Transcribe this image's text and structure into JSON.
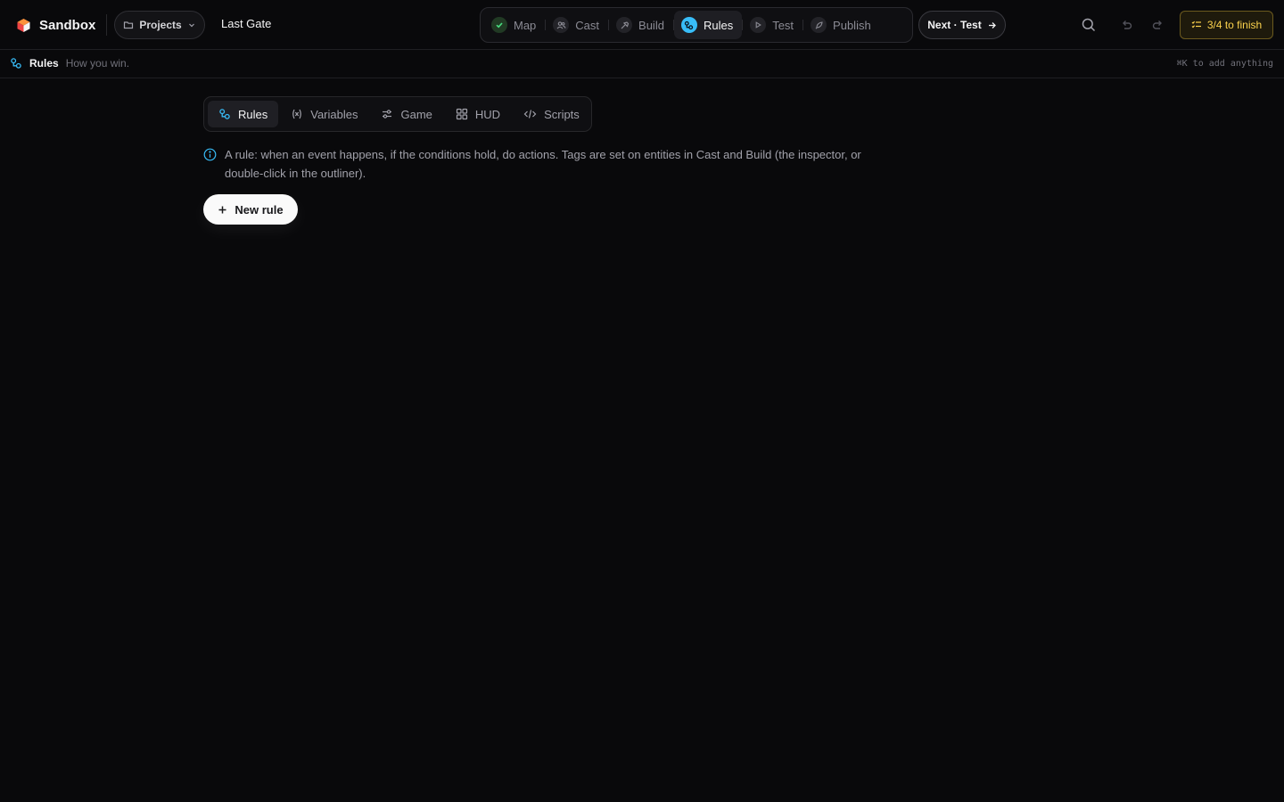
{
  "app": {
    "name": "Sandbox",
    "project_button": "Projects",
    "project_name": "Last Gate"
  },
  "steps": [
    {
      "label": "Map",
      "state": "done"
    },
    {
      "label": "Cast",
      "state": "todo"
    },
    {
      "label": "Build",
      "state": "todo"
    },
    {
      "label": "Rules",
      "state": "active"
    },
    {
      "label": "Test",
      "state": "todo"
    },
    {
      "label": "Publish",
      "state": "todo"
    }
  ],
  "toolbar": {
    "next_label": "Next · Test",
    "finish_label": "3/4 to finish"
  },
  "subbar": {
    "title": "Rules",
    "description": "How you win.",
    "hint": "⌘K to add anything"
  },
  "tabs": [
    {
      "label": "Rules",
      "icon": "rules-icon"
    },
    {
      "label": "Variables",
      "icon": "variables-icon"
    },
    {
      "label": "Game",
      "icon": "sliders-icon"
    },
    {
      "label": "HUD",
      "icon": "grid-icon"
    },
    {
      "label": "Scripts",
      "icon": "code-icon"
    }
  ],
  "info": {
    "text": "A rule: when an event happens, if the conditions hold, do actions. Tags are set on entities in Cast and Build (the inspector, or double-click in the outliner)."
  },
  "actions": {
    "new_rule_label": "New rule"
  },
  "colors": {
    "accent": "#38bdf8",
    "done": "#4ade80",
    "finish": "#fcd34d",
    "background": "#09090b"
  }
}
